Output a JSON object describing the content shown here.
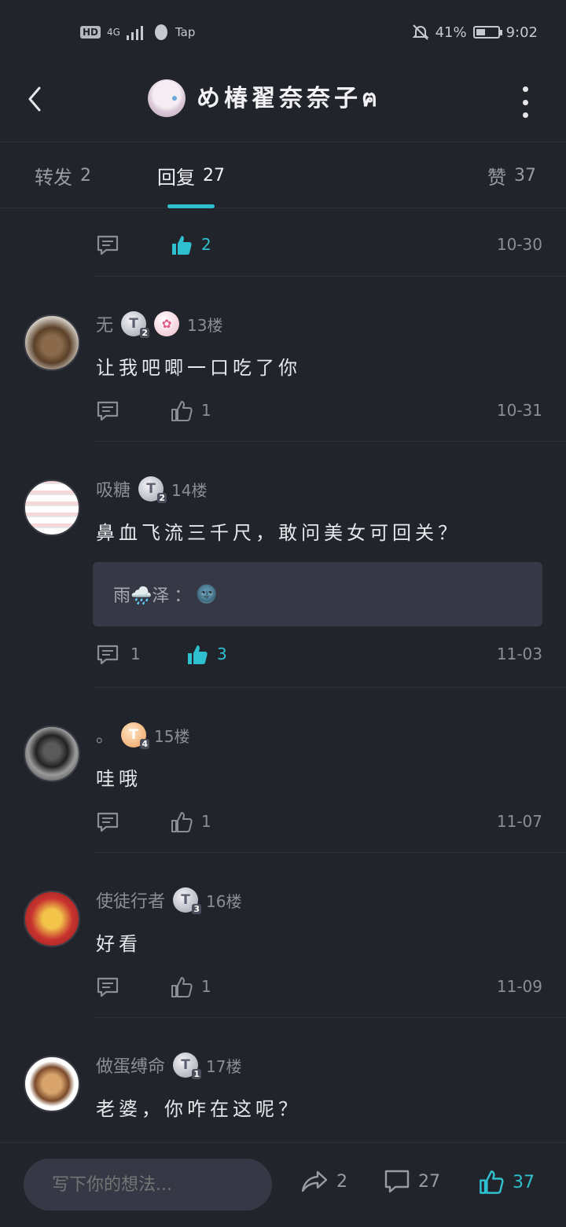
{
  "status": {
    "left_items": [
      "HD",
      "4G",
      "Tap"
    ],
    "battery_percent": "41%",
    "battery_level": 0.41,
    "time": "9:02"
  },
  "header": {
    "title": "め椿翟奈奈子ฅ"
  },
  "tabs": [
    {
      "label": "转发",
      "count": "2"
    },
    {
      "label": "回复",
      "count": "27"
    },
    {
      "label": "赞",
      "count": "37"
    }
  ],
  "replies": [
    {
      "username": "",
      "floor": "",
      "content": "",
      "comment_count": "",
      "like_count": "2",
      "liked": true,
      "date": "10-30"
    },
    {
      "username": "无",
      "badges": [
        "T2",
        "bunny"
      ],
      "floor": "13楼",
      "content": "让我吧唧一口吃了你",
      "comment_count": "",
      "like_count": "1",
      "liked": false,
      "date": "10-31"
    },
    {
      "username": "吸糖",
      "badges": [
        "T2"
      ],
      "floor": "14楼",
      "content": "鼻血飞流三千尺，敢问美女可回关？",
      "sub_reply": {
        "author": "雨🌧️泽",
        "text": "🌚"
      },
      "comment_count": "1",
      "like_count": "3",
      "liked": true,
      "date": "11-03"
    },
    {
      "username": "。",
      "badges": [
        "T4"
      ],
      "floor": "15楼",
      "content": "哇哦",
      "comment_count": "",
      "like_count": "1",
      "liked": false,
      "date": "11-07"
    },
    {
      "username": "使徒行者",
      "badges": [
        "T3"
      ],
      "floor": "16楼",
      "content": "好看",
      "comment_count": "",
      "like_count": "1",
      "liked": false,
      "date": "11-09"
    },
    {
      "username": "做蛋缚命",
      "badges": [
        "T1"
      ],
      "floor": "17楼",
      "content": "老婆，你咋在这呢？",
      "comment_count": "",
      "like_count": "",
      "liked": false,
      "date": ""
    }
  ],
  "bottom": {
    "input_placeholder": "写下你的想法...",
    "share_count": "2",
    "comment_count": "27",
    "like_count": "37"
  },
  "colors": {
    "accent": "#2fc0cf",
    "background": "#22242c"
  }
}
